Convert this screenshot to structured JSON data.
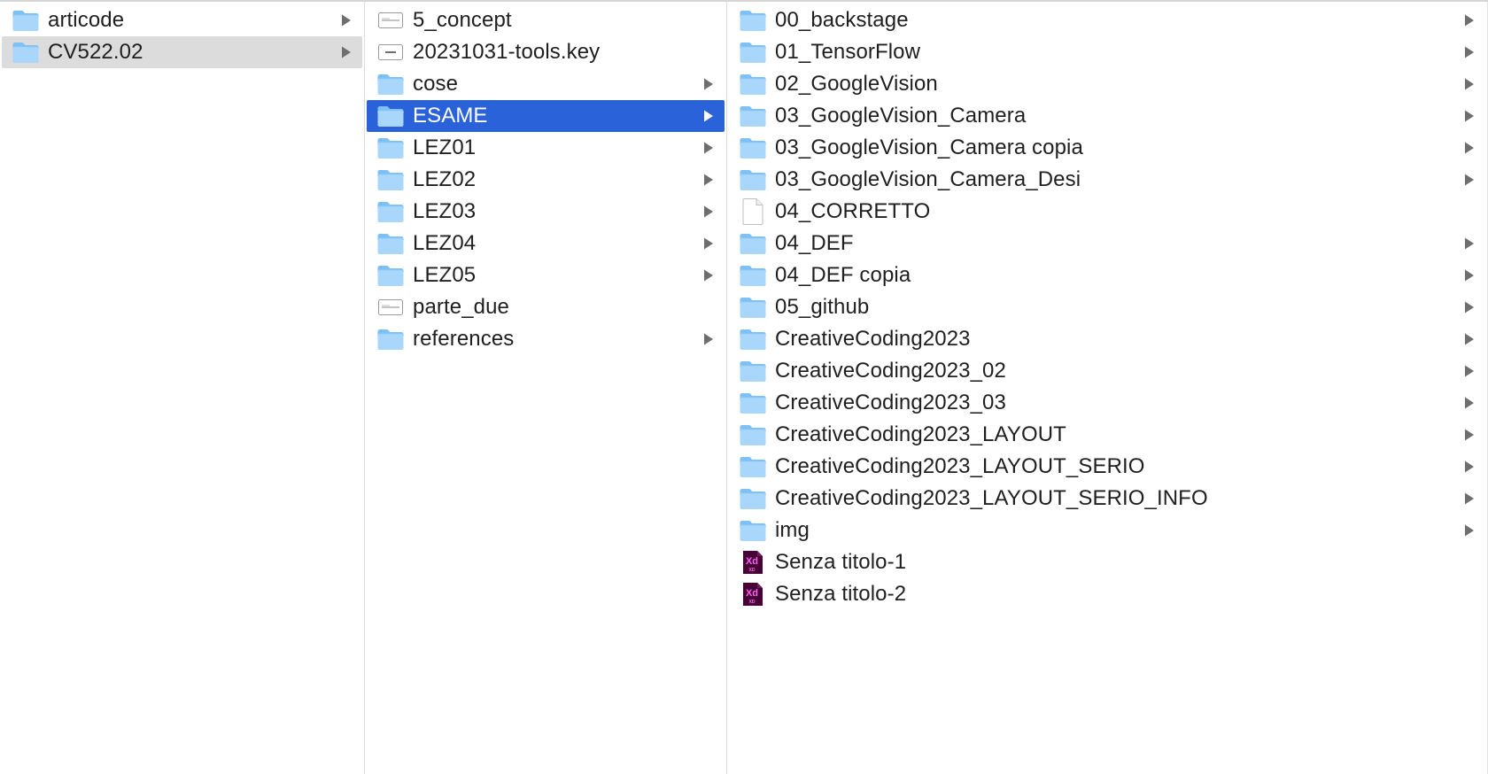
{
  "colors": {
    "selection_active": "#2a62d9",
    "selection_inactive": "#dcdcdc",
    "folder_light": "#a9d6fb",
    "folder_dark": "#7cc0f6",
    "xd_brand": "#470137",
    "xd_text": "#ff61f6"
  },
  "columns": [
    {
      "items": [
        {
          "name": "articode",
          "icon": "folder",
          "has_children": true,
          "selected": "none"
        },
        {
          "name": "CV522.02",
          "icon": "folder",
          "has_children": true,
          "selected": "inactive"
        }
      ]
    },
    {
      "items": [
        {
          "name": "5_concept",
          "icon": "document-thumbnail",
          "has_children": false,
          "selected": "none"
        },
        {
          "name": "20231031-tools.key",
          "icon": "keynote-thumbnail",
          "has_children": false,
          "selected": "none"
        },
        {
          "name": "cose",
          "icon": "folder",
          "has_children": true,
          "selected": "none"
        },
        {
          "name": "ESAME",
          "icon": "folder",
          "has_children": true,
          "selected": "active"
        },
        {
          "name": "LEZ01",
          "icon": "folder",
          "has_children": true,
          "selected": "none"
        },
        {
          "name": "LEZ02",
          "icon": "folder",
          "has_children": true,
          "selected": "none"
        },
        {
          "name": "LEZ03",
          "icon": "folder",
          "has_children": true,
          "selected": "none"
        },
        {
          "name": "LEZ04",
          "icon": "folder",
          "has_children": true,
          "selected": "none"
        },
        {
          "name": "LEZ05",
          "icon": "folder",
          "has_children": true,
          "selected": "none"
        },
        {
          "name": "parte_due",
          "icon": "document-thumbnail",
          "has_children": false,
          "selected": "none"
        },
        {
          "name": "references",
          "icon": "folder",
          "has_children": true,
          "selected": "none"
        }
      ]
    },
    {
      "items": [
        {
          "name": "00_backstage",
          "icon": "folder",
          "has_children": true,
          "selected": "none"
        },
        {
          "name": "01_TensorFlow",
          "icon": "folder",
          "has_children": true,
          "selected": "none"
        },
        {
          "name": "02_GoogleVision",
          "icon": "folder",
          "has_children": true,
          "selected": "none"
        },
        {
          "name": "03_GoogleVision_Camera",
          "icon": "folder",
          "has_children": true,
          "selected": "none"
        },
        {
          "name": "03_GoogleVision_Camera copia",
          "icon": "folder",
          "has_children": true,
          "selected": "none"
        },
        {
          "name": "03_GoogleVision_Camera_Desi",
          "icon": "folder",
          "has_children": true,
          "selected": "none"
        },
        {
          "name": "04_CORRETTO",
          "icon": "blank-document",
          "has_children": false,
          "selected": "none"
        },
        {
          "name": "04_DEF",
          "icon": "folder",
          "has_children": true,
          "selected": "none"
        },
        {
          "name": "04_DEF copia",
          "icon": "folder",
          "has_children": true,
          "selected": "none"
        },
        {
          "name": "05_github",
          "icon": "folder",
          "has_children": true,
          "selected": "none"
        },
        {
          "name": "CreativeCoding2023",
          "icon": "folder",
          "has_children": true,
          "selected": "none"
        },
        {
          "name": "CreativeCoding2023_02",
          "icon": "folder",
          "has_children": true,
          "selected": "none"
        },
        {
          "name": "CreativeCoding2023_03",
          "icon": "folder",
          "has_children": true,
          "selected": "none"
        },
        {
          "name": "CreativeCoding2023_LAYOUT",
          "icon": "folder",
          "has_children": true,
          "selected": "none"
        },
        {
          "name": "CreativeCoding2023_LAYOUT_SERIO",
          "icon": "folder",
          "has_children": true,
          "selected": "none"
        },
        {
          "name": "CreativeCoding2023_LAYOUT_SERIO_INFO",
          "icon": "folder",
          "has_children": true,
          "selected": "none"
        },
        {
          "name": "img",
          "icon": "folder",
          "has_children": true,
          "selected": "none"
        },
        {
          "name": "Senza titolo-1",
          "icon": "adobe-xd-file",
          "has_children": false,
          "selected": "none"
        },
        {
          "name": "Senza titolo-2",
          "icon": "adobe-xd-file",
          "has_children": false,
          "selected": "none"
        }
      ]
    }
  ]
}
